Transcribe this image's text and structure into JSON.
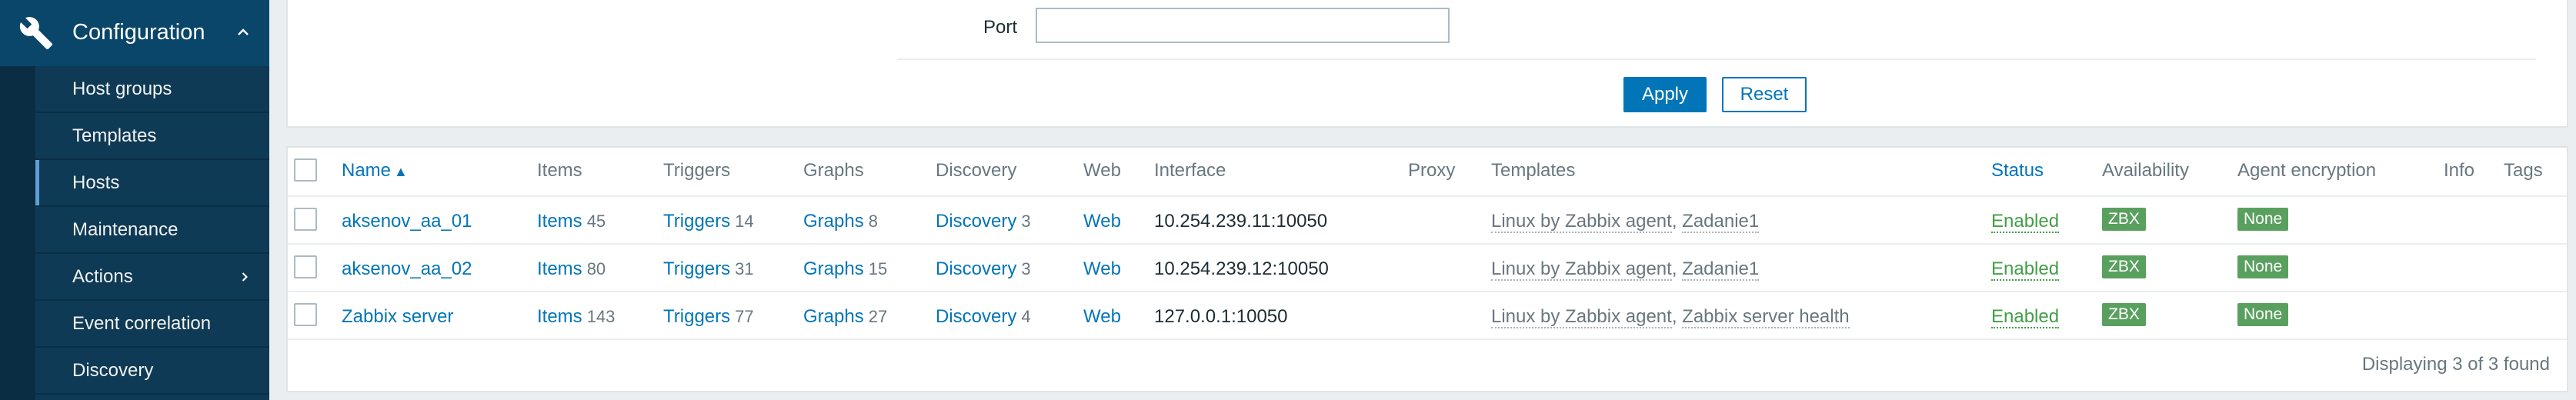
{
  "sidebar": {
    "section_title": "Configuration",
    "items": [
      {
        "label": "Host groups",
        "active": false
      },
      {
        "label": "Templates",
        "active": false
      },
      {
        "label": "Hosts",
        "active": true
      },
      {
        "label": "Maintenance",
        "active": false
      },
      {
        "label": "Actions",
        "active": false
      },
      {
        "label": "Event correlation",
        "active": false
      },
      {
        "label": "Discovery",
        "active": false
      }
    ]
  },
  "filter": {
    "port_label": "Port",
    "port_value": "",
    "apply_label": "Apply",
    "reset_label": "Reset"
  },
  "table": {
    "columns": {
      "name": "Name",
      "items": "Items",
      "triggers": "Triggers",
      "graphs": "Graphs",
      "discovery": "Discovery",
      "web": "Web",
      "interface": "Interface",
      "proxy": "Proxy",
      "templates": "Templates",
      "status": "Status",
      "availability": "Availability",
      "agent_encryption": "Agent encryption",
      "info": "Info",
      "tags": "Tags"
    },
    "sort_indicator": "▲",
    "rows": [
      {
        "name": "aksenov_aa_01",
        "items_label": "Items",
        "items_count": "45",
        "triggers_label": "Triggers",
        "triggers_count": "14",
        "graphs_label": "Graphs",
        "graphs_count": "8",
        "discovery_label": "Discovery",
        "discovery_count": "3",
        "web": "Web",
        "interface": "10.254.239.11:10050",
        "template_1": "Linux by Zabbix agent",
        "template_2": "Zadanie1",
        "status": "Enabled",
        "availability": "ZBX",
        "encryption": "None"
      },
      {
        "name": "aksenov_aa_02",
        "items_label": "Items",
        "items_count": "80",
        "triggers_label": "Triggers",
        "triggers_count": "31",
        "graphs_label": "Graphs",
        "graphs_count": "15",
        "discovery_label": "Discovery",
        "discovery_count": "3",
        "web": "Web",
        "interface": "10.254.239.12:10050",
        "template_1": "Linux by Zabbix agent",
        "template_2": "Zadanie1",
        "status": "Enabled",
        "availability": "ZBX",
        "encryption": "None"
      },
      {
        "name": "Zabbix server",
        "items_label": "Items",
        "items_count": "143",
        "triggers_label": "Triggers",
        "triggers_count": "77",
        "graphs_label": "Graphs",
        "graphs_count": "27",
        "discovery_label": "Discovery",
        "discovery_count": "4",
        "web": "Web",
        "interface": "127.0.0.1:10050",
        "template_1": "Linux by Zabbix agent",
        "template_2": "Zabbix server health",
        "status": "Enabled",
        "availability": "ZBX",
        "encryption": "None"
      }
    ],
    "footer": "Displaying 3 of 3 found"
  },
  "colors": {
    "sidebar_bg": "#0a466a",
    "accent": "#0275b8",
    "enabled": "#429e47",
    "badge_green": "#59a05f"
  }
}
